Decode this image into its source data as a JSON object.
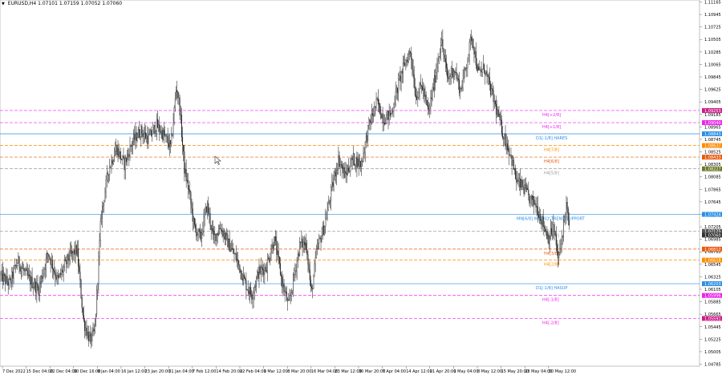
{
  "header": {
    "symbol": "EURUSD,H4",
    "ohlc": "1.07101 1.07159 1.07052 1.07060",
    "dropdown_icon": "triangle-down-icon"
  },
  "colors": {
    "candle": "#222222",
    "magenta": "#ee22ee",
    "blue": "#2b8ee8",
    "orange": "#ff8c00",
    "dark_orange": "#e85a10",
    "gray": "#9a9a9a",
    "olive": "#6b7a2a",
    "axis_text": "#000000"
  },
  "price_axis": {
    "labels": [
      "1.11165",
      "1.10945",
      "1.10725",
      "1.10505",
      "1.10285",
      "1.10065",
      "1.09845",
      "1.09625",
      "1.09405",
      "1.09185",
      "1.08965",
      "1.08745",
      "1.08525",
      "1.08305",
      "1.08085",
      "1.07865",
      "1.07645",
      "1.07425",
      "1.07205",
      "1.06985",
      "1.06765",
      "1.06545",
      "1.06325",
      "1.06105",
      "1.05885",
      "1.05665",
      "1.05445",
      "1.05225",
      "1.05005",
      "1.04785"
    ],
    "ymax": 1.112,
    "ymin": 1.0475
  },
  "time_axis": {
    "labels": [
      "7 Dec 2022",
      "15 Dec 04:00",
      "22 Dec 04:00",
      "30 Dec 16:00",
      "9 Jan 04:00",
      "16 Jan 12:00",
      "23 Jan 20:00",
      "31 Jan 04:00",
      "7 Feb 12:00",
      "14 Feb 20:00",
      "22 Feb 04:00",
      "1 Mar 12:00",
      "8 Mar 20:00",
      "16 Mar 04:00",
      "23 Mar 12:00",
      "30 Mar 20:00",
      "7 Apr 04:00",
      "14 Apr 12:00",
      "21 Apr 20:00",
      "1 May 04:00",
      "8 May 12:00",
      "15 May 20:00",
      "23 May 04:00",
      "30 May 12:00"
    ]
  },
  "levels": [
    {
      "name": "H4[+2/8]",
      "price": 1.09253,
      "badge": "1.09253",
      "color": "#ee22ee",
      "badge_color": "#cc1f8c",
      "style": "dash"
    },
    {
      "name": "H4[+1/8]",
      "price": 1.0904,
      "badge": "1.09040",
      "color": "#ee22ee",
      "badge_color": "#ee22ee",
      "style": "dash"
    },
    {
      "name": "D1[-1/8] HARES",
      "price": 1.08843,
      "badge": "1.08843",
      "color": "#2b8ee8",
      "badge_color": "#2b8ee8",
      "style": "solid"
    },
    {
      "name": "H4[7/8]",
      "price": 1.08637,
      "badge": "1.08637",
      "color": "#ff8c00",
      "badge_color": "#ff8c00",
      "style": "dash"
    },
    {
      "name": "H4[6/8]",
      "price": 1.08433,
      "badge": "1.08433",
      "color": "#e85a10",
      "badge_color": "#e85a10",
      "style": "dash"
    },
    {
      "name": "H4[5/8]",
      "price": 1.08227,
      "badge": "1.08227",
      "color": "#9a9a9a",
      "badge_color": "#6b7a2a",
      "style": "dash"
    },
    {
      "name": "MN[6/8] WEEKLY TREND SUPPORT",
      "price": 1.07424,
      "badge": "1.07424",
      "color": "#2b8ee8",
      "badge_color": "#2b8ee8",
      "style": "solid"
    },
    {
      "name": "H4[4/8]",
      "price": 1.07125,
      "badge": "1.07125",
      "color": "#9a9a9a",
      "badge_color": "#555555",
      "style": "dash"
    },
    {
      "name": "H4[3/8]",
      "price": 1.06812,
      "badge": "1.06812",
      "color": "#e85a10",
      "badge_color": "#e85a10",
      "style": "dash"
    },
    {
      "name": "H4[2/8]",
      "price": 1.06618,
      "badge": "1.06618",
      "color": "#ff8c00",
      "badge_color": "#ff8c00",
      "style": "dash"
    },
    {
      "name": "D1[-1/8] HASUP",
      "price": 1.06203,
      "badge": "1.06203",
      "color": "#2b8ee8",
      "badge_color": "#2b8ee8",
      "style": "solid"
    },
    {
      "name": "H4[-1/8]",
      "price": 1.05996,
      "badge": "1.05996",
      "color": "#ee22ee",
      "badge_color": "#ee22ee",
      "style": "dash"
    },
    {
      "name": "H4[-2/8]",
      "price": 1.05591,
      "badge": "1.05591",
      "color": "#ee22ee",
      "badge_color": "#cc1f8c",
      "style": "dash"
    }
  ],
  "current_price": {
    "label": "1.07060",
    "price": 1.0706,
    "badge_color": "#333333"
  }
}
